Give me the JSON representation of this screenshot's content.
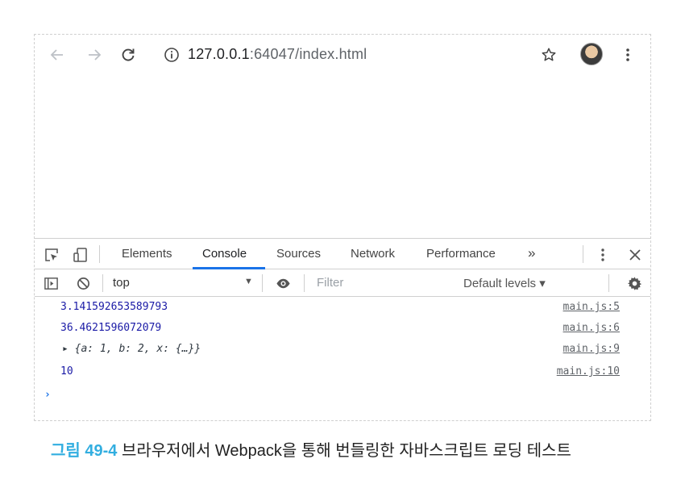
{
  "addressbar": {
    "url_host": "127.0.0.1",
    "url_rest": ":64047/index.html"
  },
  "icons": {
    "back": "arrow-left-icon",
    "forward": "arrow-right-icon",
    "reload": "reload-icon",
    "info": "info-icon",
    "star": "star-icon",
    "avatar": "profile-avatar",
    "menu": "kebab-menu-icon"
  },
  "devtools": {
    "tabs": [
      "Elements",
      "Console",
      "Sources",
      "Network",
      "Performance"
    ],
    "active_tab": "Console",
    "more_tabs": "»",
    "close": "✕",
    "context": "top",
    "filter_placeholder": "Filter",
    "levels": "Default levels ▾",
    "accent": "#1a73e8"
  },
  "console": {
    "rows": [
      {
        "value": "3.141592653589793",
        "source": "main.js:5"
      },
      {
        "value": "36.4621596072079",
        "source": "main.js:6"
      },
      {
        "value": "▸ {a: 1, b: 2, x: {…}}",
        "source": "main.js:9"
      },
      {
        "value": "10",
        "source": "main.js:10"
      }
    ],
    "prompt": "›"
  },
  "caption": {
    "figure": "그림 49-4",
    "text": "브라우저에서 Webpack을 통해 번들링한 자바스크립트 로딩 테스트",
    "color": "#32aee0"
  }
}
